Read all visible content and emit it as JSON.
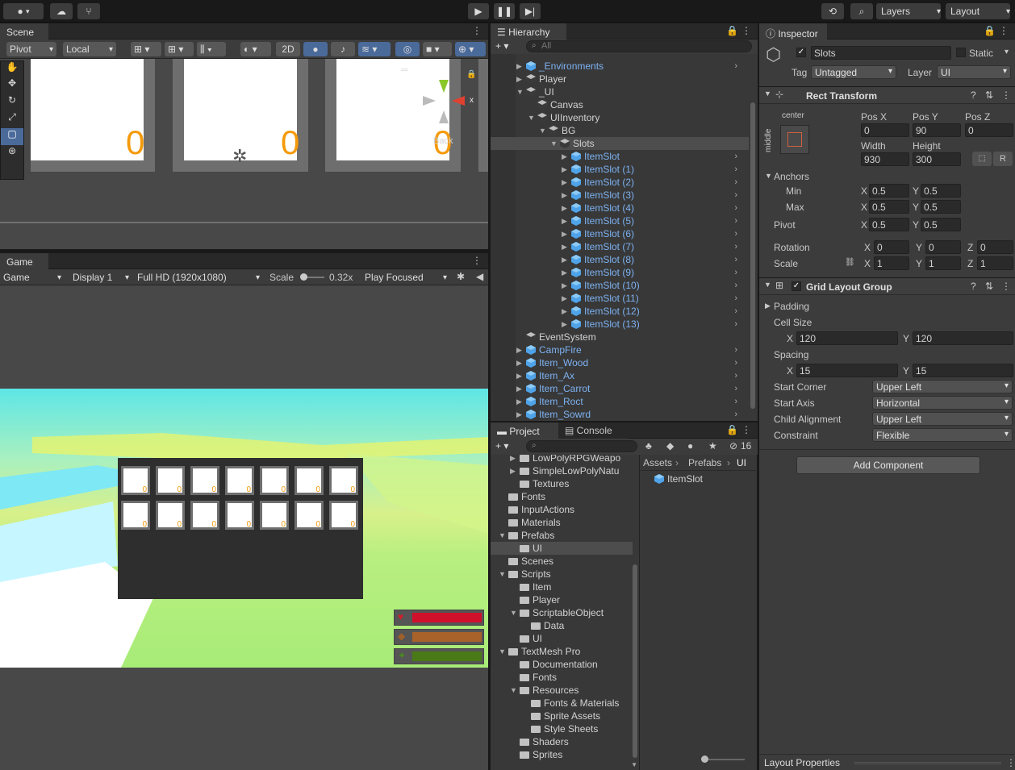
{
  "topbar": {
    "layers": "Layers",
    "layout": "Layout"
  },
  "scene": {
    "tab": "Scene",
    "pivot": "Pivot",
    "local": "Local",
    "mode2d": "2D",
    "counters": [
      "0",
      "0",
      "0"
    ],
    "back_label": "Back"
  },
  "game": {
    "tab": "Game",
    "display_mode": "Game",
    "display": "Display 1",
    "resolution": "Full HD (1920x1080)",
    "scale_label": "Scale",
    "scale_value": "0.32x",
    "play_mode": "Play Focused",
    "slot_count": "0"
  },
  "hierarchy": {
    "tab": "Hierarchy",
    "search_placeholder": "All",
    "items": [
      {
        "label": "_Environments",
        "indent": 1,
        "blue": true,
        "fold": "▶",
        "arrow": true
      },
      {
        "label": "Player",
        "indent": 1,
        "blue": false,
        "fold": "▶",
        "arrow": false
      },
      {
        "label": "_UI",
        "indent": 1,
        "blue": false,
        "fold": "▼",
        "arrow": false
      },
      {
        "label": "Canvas",
        "indent": 2,
        "blue": false,
        "fold": "",
        "arrow": false
      },
      {
        "label": "UIInventory",
        "indent": 2,
        "blue": false,
        "fold": "▼",
        "arrow": false
      },
      {
        "label": "BG",
        "indent": 3,
        "blue": false,
        "fold": "▼",
        "arrow": false
      },
      {
        "label": "Slots",
        "indent": 4,
        "blue": false,
        "fold": "▼",
        "arrow": false,
        "selected": true
      },
      {
        "label": "ItemSlot",
        "indent": 5,
        "blue": true,
        "fold": "▶",
        "arrow": true
      },
      {
        "label": "ItemSlot (1)",
        "indent": 5,
        "blue": true,
        "fold": "▶",
        "arrow": true
      },
      {
        "label": "ItemSlot (2)",
        "indent": 5,
        "blue": true,
        "fold": "▶",
        "arrow": true
      },
      {
        "label": "ItemSlot (3)",
        "indent": 5,
        "blue": true,
        "fold": "▶",
        "arrow": true
      },
      {
        "label": "ItemSlot (4)",
        "indent": 5,
        "blue": true,
        "fold": "▶",
        "arrow": true
      },
      {
        "label": "ItemSlot (5)",
        "indent": 5,
        "blue": true,
        "fold": "▶",
        "arrow": true
      },
      {
        "label": "ItemSlot (6)",
        "indent": 5,
        "blue": true,
        "fold": "▶",
        "arrow": true
      },
      {
        "label": "ItemSlot (7)",
        "indent": 5,
        "blue": true,
        "fold": "▶",
        "arrow": true
      },
      {
        "label": "ItemSlot (8)",
        "indent": 5,
        "blue": true,
        "fold": "▶",
        "arrow": true
      },
      {
        "label": "ItemSlot (9)",
        "indent": 5,
        "blue": true,
        "fold": "▶",
        "arrow": true
      },
      {
        "label": "ItemSlot (10)",
        "indent": 5,
        "blue": true,
        "fold": "▶",
        "arrow": true
      },
      {
        "label": "ItemSlot (11)",
        "indent": 5,
        "blue": true,
        "fold": "▶",
        "arrow": true
      },
      {
        "label": "ItemSlot (12)",
        "indent": 5,
        "blue": true,
        "fold": "▶",
        "arrow": true
      },
      {
        "label": "ItemSlot (13)",
        "indent": 5,
        "blue": true,
        "fold": "▶",
        "arrow": true
      },
      {
        "label": "EventSystem",
        "indent": 1,
        "blue": false,
        "fold": "",
        "arrow": false
      },
      {
        "label": "CampFire",
        "indent": 1,
        "blue": true,
        "fold": "▶",
        "arrow": true
      },
      {
        "label": "Item_Wood",
        "indent": 1,
        "blue": true,
        "fold": "▶",
        "arrow": true
      },
      {
        "label": "Item_Ax",
        "indent": 1,
        "blue": true,
        "fold": "▶",
        "arrow": true
      },
      {
        "label": "Item_Carrot",
        "indent": 1,
        "blue": true,
        "fold": "▶",
        "arrow": true
      },
      {
        "label": "Item_Roct",
        "indent": 1,
        "blue": true,
        "fold": "▶",
        "arrow": true
      },
      {
        "label": "Item_Sowrd",
        "indent": 1,
        "blue": true,
        "fold": "▶",
        "arrow": true
      }
    ]
  },
  "project": {
    "tab_project": "Project",
    "tab_console": "Console",
    "hidden_count": "16",
    "breadcrumb": [
      "Assets",
      "Prefabs",
      "UI"
    ],
    "asset": "ItemSlot",
    "tree": [
      {
        "label": "LowPolyRPGWeapo",
        "indent": 2,
        "fold": "▶"
      },
      {
        "label": "SimpleLowPolyNatu",
        "indent": 2,
        "fold": "▶"
      },
      {
        "label": "Textures",
        "indent": 2,
        "fold": ""
      },
      {
        "label": "Fonts",
        "indent": 1,
        "fold": ""
      },
      {
        "label": "InputActions",
        "indent": 1,
        "fold": ""
      },
      {
        "label": "Materials",
        "indent": 1,
        "fold": ""
      },
      {
        "label": "Prefabs",
        "indent": 1,
        "fold": "▼"
      },
      {
        "label": "UI",
        "indent": 2,
        "fold": "",
        "selected": true
      },
      {
        "label": "Scenes",
        "indent": 1,
        "fold": ""
      },
      {
        "label": "Scripts",
        "indent": 1,
        "fold": "▼"
      },
      {
        "label": "Item",
        "indent": 2,
        "fold": ""
      },
      {
        "label": "Player",
        "indent": 2,
        "fold": ""
      },
      {
        "label": "ScriptableObject",
        "indent": 2,
        "fold": "▼"
      },
      {
        "label": "Data",
        "indent": 3,
        "fold": ""
      },
      {
        "label": "UI",
        "indent": 2,
        "fold": ""
      },
      {
        "label": "TextMesh Pro",
        "indent": 1,
        "fold": "▼"
      },
      {
        "label": "Documentation",
        "indent": 2,
        "fold": ""
      },
      {
        "label": "Fonts",
        "indent": 2,
        "fold": ""
      },
      {
        "label": "Resources",
        "indent": 2,
        "fold": "▼"
      },
      {
        "label": "Fonts & Materials",
        "indent": 3,
        "fold": ""
      },
      {
        "label": "Sprite Assets",
        "indent": 3,
        "fold": ""
      },
      {
        "label": "Style Sheets",
        "indent": 3,
        "fold": ""
      },
      {
        "label": "Shaders",
        "indent": 2,
        "fold": ""
      },
      {
        "label": "Sprites",
        "indent": 2,
        "fold": ""
      }
    ]
  },
  "inspector": {
    "tab": "Inspector",
    "name": "Slots",
    "static_label": "Static",
    "tag_label": "Tag",
    "tag": "Untagged",
    "layer_label": "Layer",
    "layer": "UI",
    "rect": {
      "title": "Rect Transform",
      "anchor_h": "center",
      "anchor_v": "middle",
      "posx_label": "Pos X",
      "posy_label": "Pos Y",
      "posz_label": "Pos Z",
      "posx": "0",
      "posy": "90",
      "posz": "0",
      "width_label": "Width",
      "height_label": "Height",
      "width": "930",
      "height": "300",
      "r_button": "R",
      "anchors_label": "Anchors",
      "min_label": "Min",
      "max_label": "Max",
      "min_x": "0.5",
      "min_y": "0.5",
      "max_x": "0.5",
      "max_y": "0.5",
      "pivot_label": "Pivot",
      "pivot_x": "0.5",
      "pivot_y": "0.5",
      "rotation_label": "Rotation",
      "rot_x": "0",
      "rot_y": "0",
      "rot_z": "0",
      "scale_label": "Scale",
      "scale_x": "1",
      "scale_y": "1",
      "scale_z": "1"
    },
    "grid": {
      "title": "Grid Layout Group",
      "padding": "Padding",
      "cell_size": "Cell Size",
      "cell_x": "120",
      "cell_y": "120",
      "spacing": "Spacing",
      "spacing_x": "15",
      "spacing_y": "15",
      "start_corner_label": "Start Corner",
      "start_corner": "Upper Left",
      "start_axis_label": "Start Axis",
      "start_axis": "Horizontal",
      "child_alignment_label": "Child Alignment",
      "child_alignment": "Upper Left",
      "constraint_label": "Constraint",
      "constraint": "Flexible"
    },
    "add_component": "Add Component",
    "layout_properties": "Layout Properties"
  }
}
